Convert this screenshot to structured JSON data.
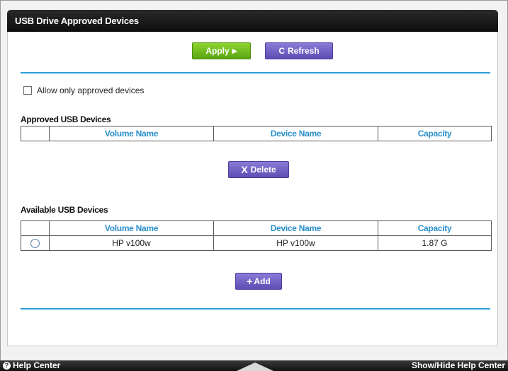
{
  "header": {
    "title": "USB Drive Approved Devices"
  },
  "toolbar": {
    "apply_label": "Apply",
    "apply_icon": "▶",
    "refresh_label": "Refresh",
    "refresh_icon": "C"
  },
  "options": {
    "allow_only_approved_label": "Allow only approved devices",
    "allow_only_approved_checked": false
  },
  "approved": {
    "title": "Approved USB Devices",
    "columns": [
      "",
      "Volume Name",
      "Device Name",
      "Capacity"
    ],
    "delete_label": "Delete",
    "delete_icon": "X"
  },
  "available": {
    "title": "Available USB Devices",
    "columns": [
      "",
      "Volume Name",
      "Device Name",
      "Capacity"
    ],
    "rows": [
      {
        "volume_name": "HP v100w",
        "device_name": "HP v100w",
        "capacity": "1.87 G"
      }
    ],
    "add_label": "Add",
    "add_icon": "+"
  },
  "footer": {
    "help_center_label": "Help Center",
    "help_icon": "?",
    "show_hide_label": "Show/Hide Help Center"
  },
  "colors": {
    "title_bar": "#111111",
    "accent_blue": "#2b9ed8",
    "apply_green": "#6cb81e",
    "button_purple": "#6f5ec4"
  }
}
